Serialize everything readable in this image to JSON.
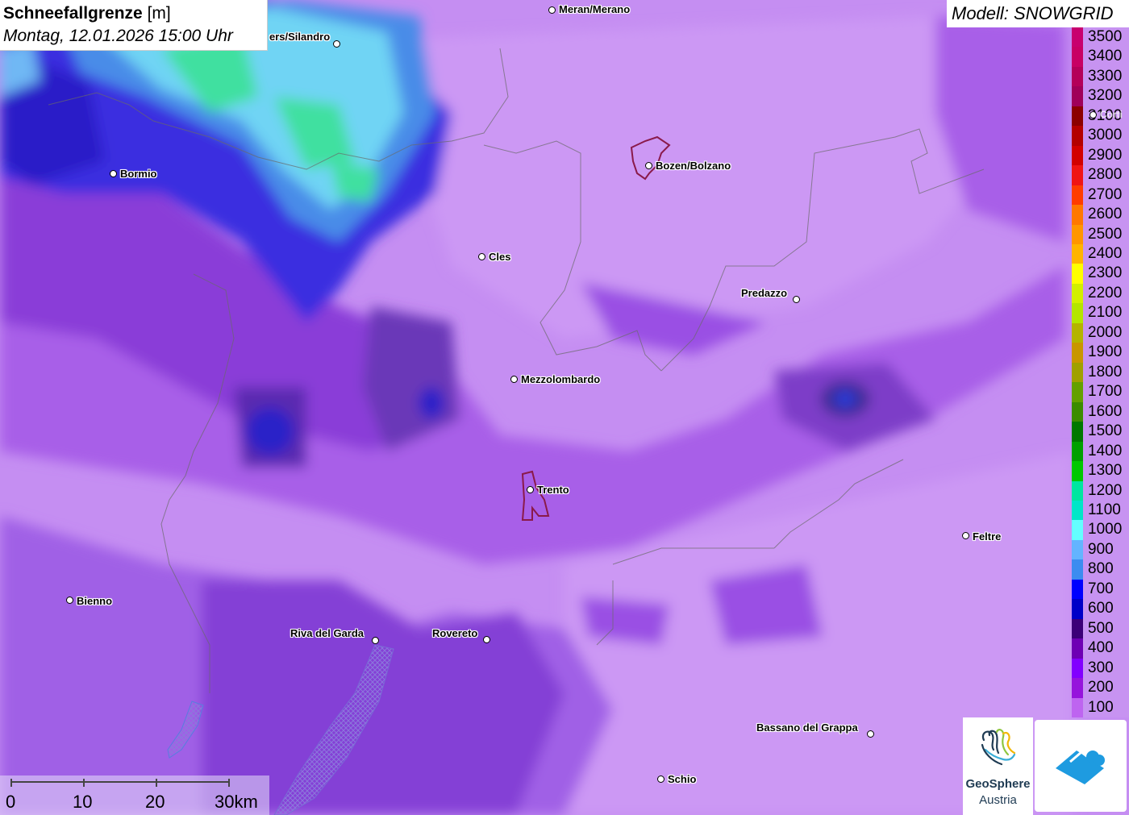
{
  "title": {
    "main": "Schneefallgrenze",
    "unit": "[m]",
    "datetime": "Montag, 12.01.2026 15:00 Uhr"
  },
  "model": {
    "label": "Modell: SNOWGRID"
  },
  "legend": {
    "items": [
      {
        "label": "3500",
        "color": "#c8006e"
      },
      {
        "label": "3400",
        "color": "#c80064"
      },
      {
        "label": "3300",
        "color": "#b4005a"
      },
      {
        "label": "3200",
        "color": "#a0005a"
      },
      {
        "label": "3100",
        "color": "#8c0000"
      },
      {
        "label": "3000",
        "color": "#b40000"
      },
      {
        "label": "2900",
        "color": "#d20000"
      },
      {
        "label": "2800",
        "color": "#f01414"
      },
      {
        "label": "2700",
        "color": "#ff3c00"
      },
      {
        "label": "2600",
        "color": "#ff7800"
      },
      {
        "label": "2500",
        "color": "#ff9600"
      },
      {
        "label": "2400",
        "color": "#ffb400"
      },
      {
        "label": "2300",
        "color": "#ffff00"
      },
      {
        "label": "2200",
        "color": "#d2f000"
      },
      {
        "label": "2100",
        "color": "#b4e600"
      },
      {
        "label": "2000",
        "color": "#b4b400"
      },
      {
        "label": "1900",
        "color": "#c89600"
      },
      {
        "label": "1800",
        "color": "#a0a000"
      },
      {
        "label": "1700",
        "color": "#64a000"
      },
      {
        "label": "1600",
        "color": "#3c8c00"
      },
      {
        "label": "1500",
        "color": "#007800"
      },
      {
        "label": "1400",
        "color": "#00a000"
      },
      {
        "label": "1300",
        "color": "#00c800"
      },
      {
        "label": "1200",
        "color": "#00e6a0"
      },
      {
        "label": "1100",
        "color": "#00e6c8"
      },
      {
        "label": "1000",
        "color": "#64ffff"
      },
      {
        "label": "900",
        "color": "#64b4ff"
      },
      {
        "label": "800",
        "color": "#3c8cf0"
      },
      {
        "label": "700",
        "color": "#0000ff"
      },
      {
        "label": "600",
        "color": "#0000c8"
      },
      {
        "label": "500",
        "color": "#3c0078"
      },
      {
        "label": "400",
        "color": "#6e00b4"
      },
      {
        "label": "300",
        "color": "#8200ff"
      },
      {
        "label": "200",
        "color": "#9614dc"
      },
      {
        "label": "100",
        "color": "#be64f0"
      }
    ]
  },
  "cities": [
    {
      "name": "Meran/Merano"
    },
    {
      "name": "ers/Silandro"
    },
    {
      "name": "Bormio"
    },
    {
      "name": "Bozen/Bolzano"
    },
    {
      "name": "Cles"
    },
    {
      "name": "Predazzo"
    },
    {
      "name": "Mezzolombardo"
    },
    {
      "name": "Trento"
    },
    {
      "name": "Feltre"
    },
    {
      "name": "Bienno"
    },
    {
      "name": "Riva del Garda"
    },
    {
      "name": "Rovereto"
    },
    {
      "name": "Bassano del Grappa"
    },
    {
      "name": "Schio"
    },
    {
      "name": "Corti"
    }
  ],
  "scale": {
    "labels": [
      "0",
      "10",
      "20",
      "30km"
    ]
  },
  "logo": {
    "line1": "GeoSphere",
    "line2": "Austria"
  },
  "colors": {
    "background": "#c38cf0",
    "high_zone": "#00e6a0",
    "low_zone": "#3c0078"
  }
}
